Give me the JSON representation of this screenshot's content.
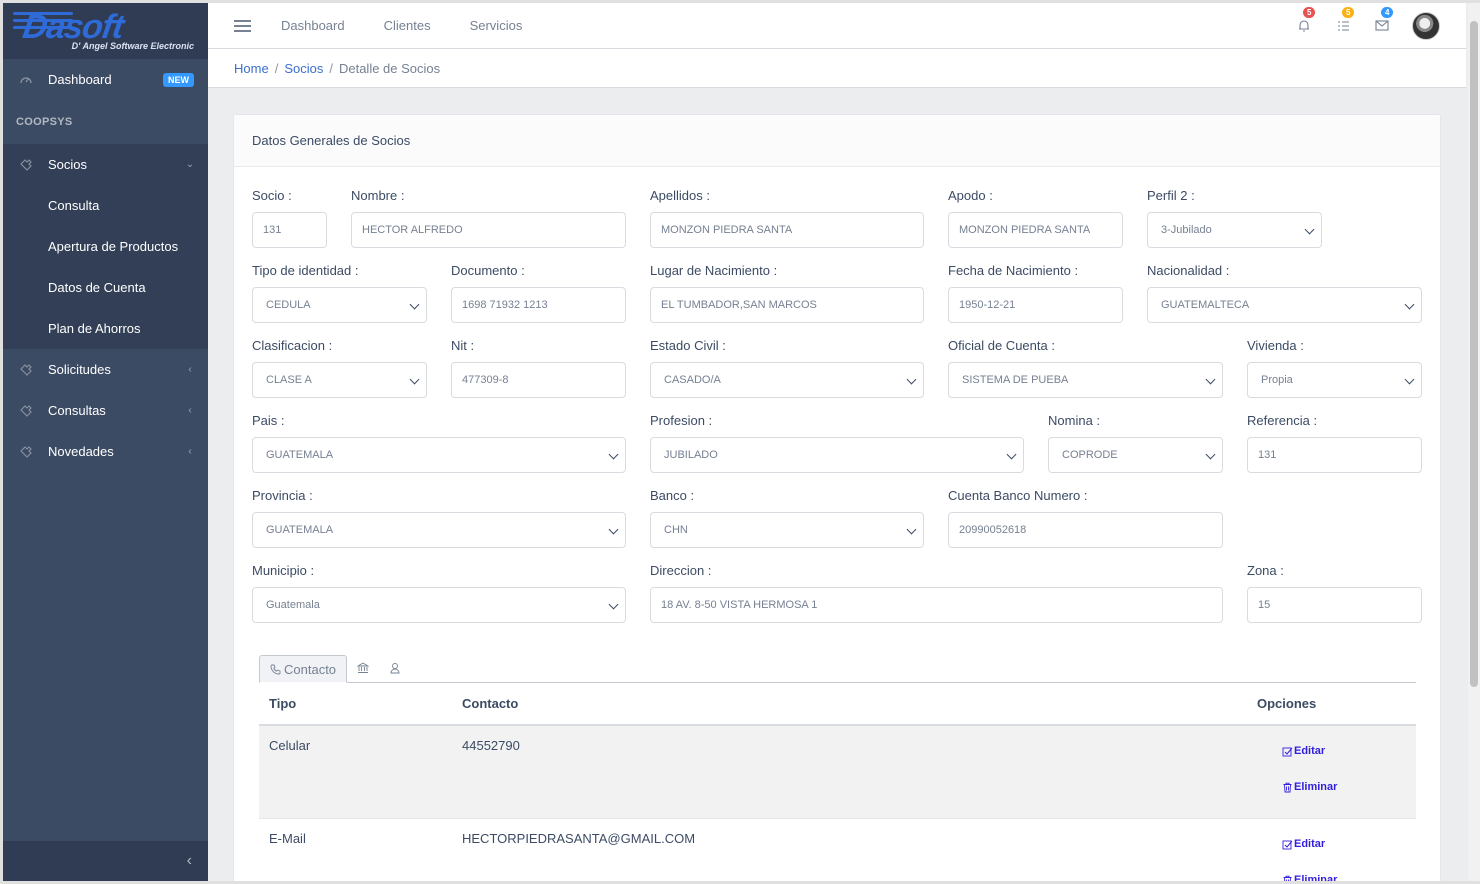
{
  "brand": {
    "logo": "Dasoft",
    "tagline": "D' Angel Software Electronic"
  },
  "sidebar": {
    "dashboard": {
      "label": "Dashboard",
      "badge": "NEW"
    },
    "section_title": "COOPSYS",
    "socios": {
      "label": "Socios",
      "children": [
        "Consulta",
        "Apertura de Productos",
        "Datos de Cuenta",
        "Plan de Ahorros"
      ]
    },
    "groups": [
      "Solicitudes",
      "Consultas",
      "Novedades"
    ]
  },
  "header": {
    "nav": [
      "Dashboard",
      "Clientes",
      "Servicios"
    ],
    "badges": {
      "notifications": "5",
      "tasks": "5",
      "messages": "4"
    },
    "colors": {
      "notifications": "#e55353",
      "tasks": "#f9b115",
      "messages": "#39f"
    }
  },
  "breadcrumb": {
    "home": "Home",
    "section": "Socios",
    "current": "Detalle de Socios"
  },
  "card": {
    "title": "Datos Generales de Socios"
  },
  "form": {
    "socio": {
      "label": "Socio :",
      "value": "131"
    },
    "nombre": {
      "label": "Nombre :",
      "value": "HECTOR ALFREDO"
    },
    "apellidos": {
      "label": "Apellidos :",
      "value": "MONZON PIEDRA SANTA"
    },
    "apodo": {
      "label": "Apodo :",
      "value": "MONZON PIEDRA SANTA"
    },
    "perfil2": {
      "label": "Perfil 2 :",
      "value": "3-Jubilado"
    },
    "tipo_identidad": {
      "label": "Tipo de identidad :",
      "value": "CEDULA"
    },
    "documento": {
      "label": "Documento :",
      "value": "1698 71932 1213"
    },
    "lugar_nacimiento": {
      "label": "Lugar de Nacimiento :",
      "value": "EL TUMBADOR,SAN MARCOS"
    },
    "fecha_nacimiento": {
      "label": "Fecha de Nacimiento :",
      "value": "1950-12-21"
    },
    "nacionalidad": {
      "label": "Nacionalidad :",
      "value": "GUATEMALTECA"
    },
    "clasificacion": {
      "label": "Clasificacion :",
      "value": "CLASE A"
    },
    "nit": {
      "label": "Nit :",
      "value": "477309-8"
    },
    "estado_civil": {
      "label": "Estado Civil :",
      "value": "CASADO/A"
    },
    "oficial_cuenta": {
      "label": "Oficial de Cuenta :",
      "value": "SISTEMA DE PUEBA"
    },
    "vivienda": {
      "label": "Vivienda :",
      "value": "Propia"
    },
    "pais": {
      "label": "Pais :",
      "value": "GUATEMALA"
    },
    "profesion": {
      "label": "Profesion :",
      "value": "JUBILADO"
    },
    "nomina": {
      "label": "Nomina :",
      "value": "COPRODE"
    },
    "referencia": {
      "label": "Referencia :",
      "value": "131"
    },
    "provincia": {
      "label": "Provincia :",
      "value": "GUATEMALA"
    },
    "banco": {
      "label": "Banco :",
      "value": "CHN"
    },
    "cuenta_banco": {
      "label": "Cuenta Banco Numero :",
      "value": "20990052618"
    },
    "municipio": {
      "label": "Municipio :",
      "value": "Guatemala"
    },
    "direccion": {
      "label": "Direccion :",
      "value": "18 AV. 8-50 VISTA HERMOSA 1"
    },
    "zona": {
      "label": "Zona :",
      "value": "15"
    }
  },
  "tabs": {
    "contacto": "Contacto"
  },
  "table": {
    "headers": {
      "tipo": "Tipo",
      "contacto": "Contacto",
      "opciones": "Opciones"
    },
    "rows": [
      {
        "tipo": "Celular",
        "contacto": "44552790",
        "editar": "Editar",
        "eliminar": "Eliminar"
      },
      {
        "tipo": "E-Mail",
        "contacto": "HECTORPIEDRASANTA@GMAIL.COM",
        "editar": "Editar",
        "eliminar": "Eliminar"
      }
    ]
  }
}
